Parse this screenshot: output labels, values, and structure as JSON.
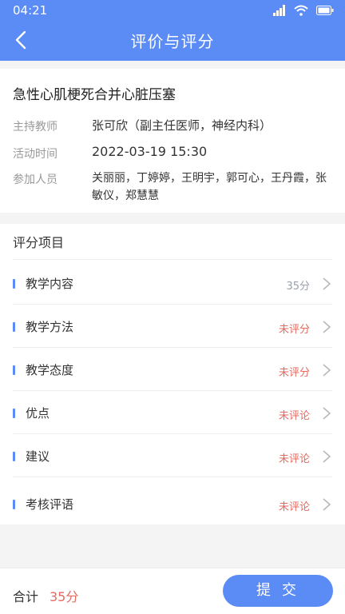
{
  "status_bar": {
    "time": "04:21"
  },
  "nav": {
    "title": "评价与评分"
  },
  "activity": {
    "title": "急性心肌梗死合并心脏压塞",
    "rows": [
      {
        "label": "主持教师",
        "value": "张可欣（副主任医师，神经内科）"
      },
      {
        "label": "活动时间",
        "value": "2022-03-19 15:30"
      },
      {
        "label": "参加人员",
        "value": "关丽丽，丁婷婷，王明宇，郭可心，王丹霞，张敏仪，郑慧慧"
      }
    ]
  },
  "scoring": {
    "header": "评分项目",
    "items": [
      {
        "name": "教学内容",
        "value": "35分",
        "status": "done"
      },
      {
        "name": "教学方法",
        "value": "未评分",
        "status": "todo"
      },
      {
        "name": "教学态度",
        "value": "未评分",
        "status": "todo"
      },
      {
        "name": "优点",
        "value": "未评论",
        "status": "todo"
      },
      {
        "name": "建议",
        "value": "未评论",
        "status": "todo"
      },
      {
        "name": "考核评语",
        "value": "未评论",
        "status": "todo"
      }
    ]
  },
  "footer": {
    "total_label": "合计",
    "total_value": "35分",
    "submit_label": "提交"
  },
  "colors": {
    "primary": "#5b8bf5",
    "warning": "#e46a5f",
    "muted": "#9aa0aa"
  },
  "icons": {
    "back": "chevron-left-icon",
    "item_arrow": "chevron-right-icon",
    "signal": "signal-icon",
    "wifi": "wifi-icon",
    "battery": "battery-icon"
  }
}
